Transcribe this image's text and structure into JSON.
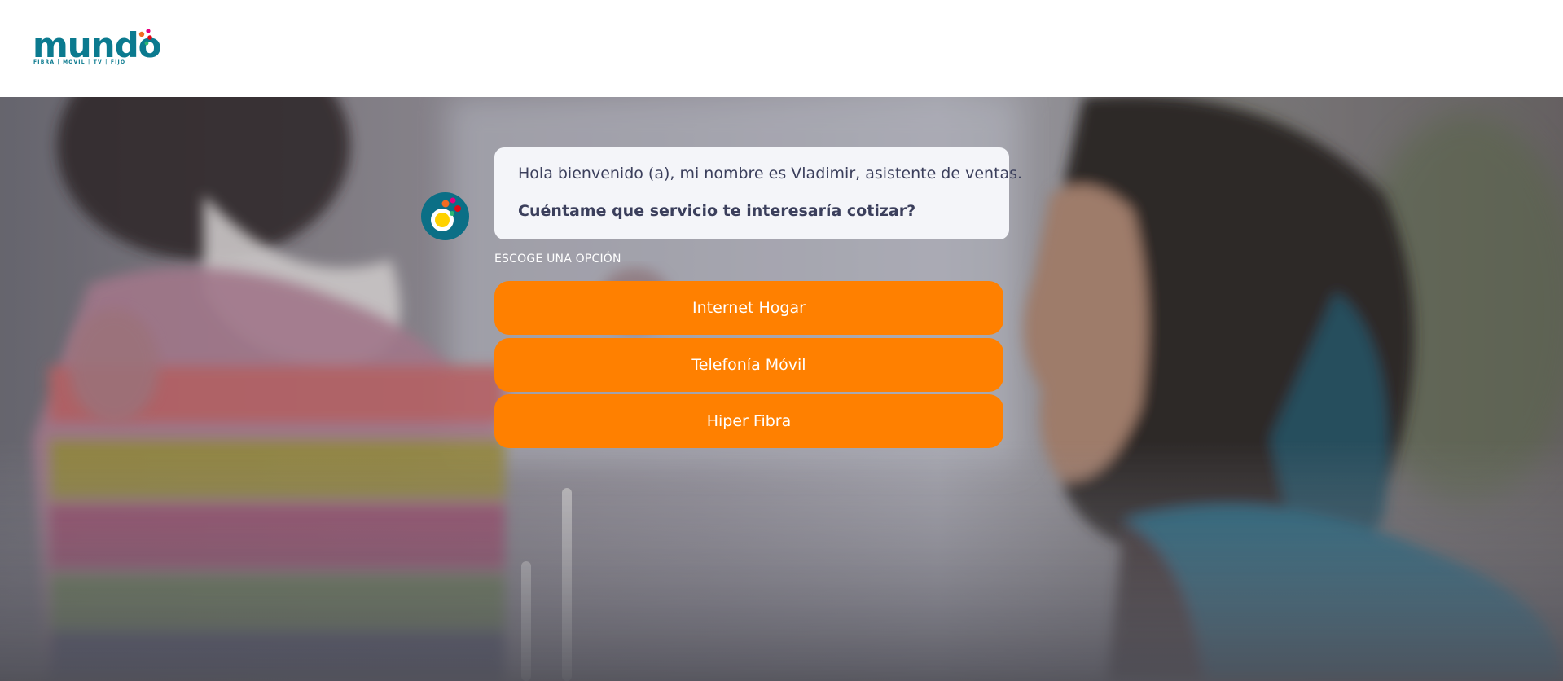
{
  "header": {
    "logo_text": "mundo",
    "logo_tagline": "FIBRA | MÓVIL | TV | FIJO"
  },
  "chat": {
    "greeting": "Hola bienvenido (a), mi nombre es Vladimir, asistente de ventas.",
    "question": "Cuéntame que servicio te interesaría cotizar?",
    "choose_label": "ESCOGE UNA OPCIÓN",
    "options": [
      {
        "label": "Internet Hogar"
      },
      {
        "label": "Telefonía Móvil"
      },
      {
        "label": "Hiper Fibra"
      }
    ]
  },
  "colors": {
    "brand_teal": "#0b7a8f",
    "option_orange": "#ff8000",
    "bubble_bg": "#f4f5f9",
    "bubble_text": "#3b3f5c"
  },
  "icons": {
    "logo": "mundo-logo-icon",
    "bot_avatar": "bot-avatar-icon"
  }
}
